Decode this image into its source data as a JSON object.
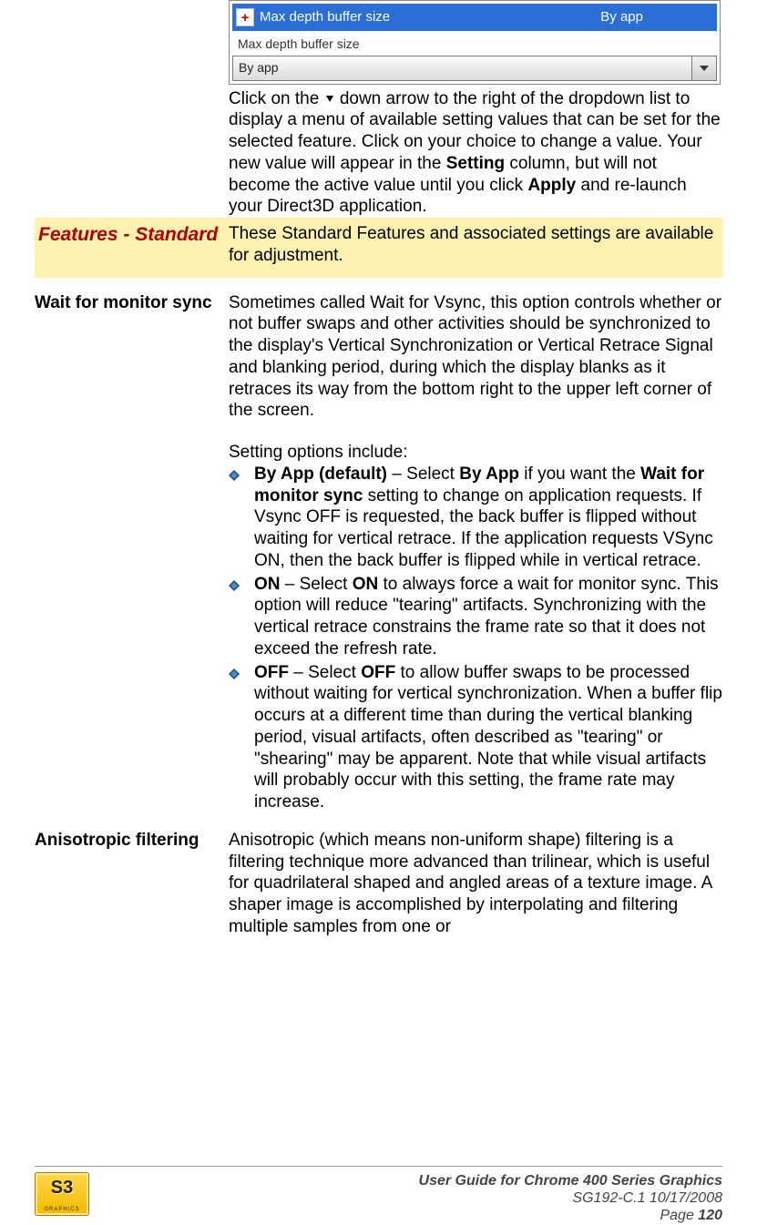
{
  "screenshot": {
    "selected_label": "Max depth buffer size",
    "selected_value": "By app",
    "detail_label": "Max depth buffer size",
    "combo_value": "By app"
  },
  "intro": {
    "p1_a": "Click on the ",
    "p1_b": " down arrow to the right of the dropdown list to display a menu of available setting values that can be set for the selected feature. Click on your choice to change a value. Your new value will appear in the ",
    "p1_setting": "Setting",
    "p1_c": " column, but will not become the active value until you click ",
    "p1_apply": "Apply",
    "p1_d": " and re-launch your Direct3D application."
  },
  "features": {
    "title": "Features - Standard",
    "desc": "These Standard Features and associated settings are available for adjustment."
  },
  "wait": {
    "title": "Wait for monitor sync",
    "p1": "Sometimes called Wait for Vsync, this option controls whether or not buffer swaps and other activities should be synchronized to the display's Vertical Synchronization or Vertical Retrace Signal and blanking period, during which the display blanks as it retraces its way from the bottom right to the upper left corner of the screen.",
    "p2": "Setting options include:",
    "opts": [
      {
        "b1": "By App (default)",
        "t1": " – Select ",
        "b2": "By App",
        "t2": " if you want the ",
        "b3": "Wait for monitor sync",
        "t3": " setting to change on application requests. If Vsync OFF is requested, the back buffer is flipped without waiting for vertical retrace. If the application requests VSync ON, then the back buffer is flipped while in vertical retrace."
      },
      {
        "b1": "ON",
        "t1": " – Select ",
        "b2": "ON",
        "t2": " to always force a wait for monitor sync. This option will reduce \"tearing\" artifacts. Synchronizing with the vertical retrace constrains the frame rate so that it does not exceed the refresh rate.",
        "b3": "",
        "t3": ""
      },
      {
        "b1": "OFF",
        "t1": " – Select ",
        "b2": "OFF",
        "t2": " to allow buffer swaps to be processed without waiting for vertical synchronization. When a buffer flip occurs at a different time than during the vertical blanking period, visual artifacts, often described as \"tearing\" or \"shearing\" may be apparent. Note that while visual artifacts will probably occur with this setting, the frame rate may increase.",
        "b3": "",
        "t3": ""
      }
    ]
  },
  "aniso": {
    "title": "Anisotropic filtering",
    "p1": "Anisotropic (which means non-uniform shape) filtering is a filtering technique more advanced than trilinear, which is useful for quadrilateral shaped and angled areas of a texture image. A shaper image is accomplished by interpolating and filtering multiple samples from one or"
  },
  "footer": {
    "line1": "User Guide for Chrome 400 Series Graphics",
    "line2": "SG192-C.1   10/17/2008",
    "page_label": "Page ",
    "page_num": "120"
  }
}
